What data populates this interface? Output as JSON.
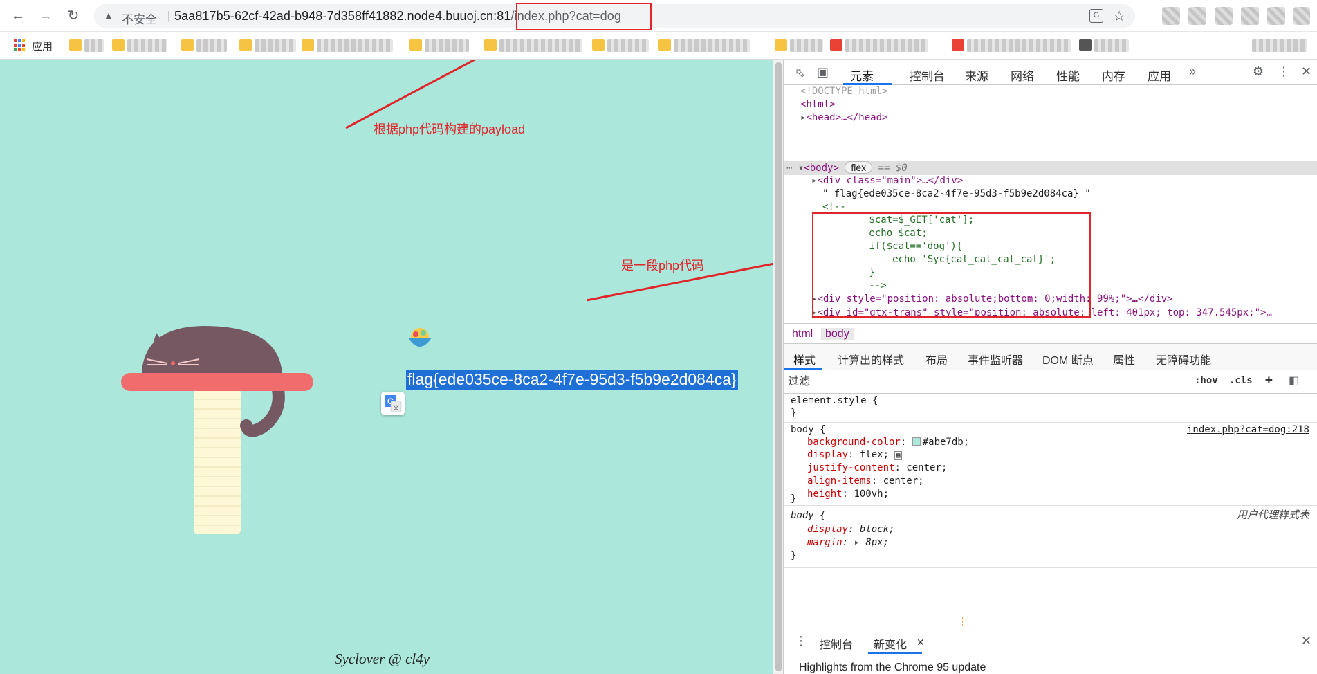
{
  "browser": {
    "insecure_label": "不安全",
    "url_host": "5aa817b5-62cf-42ad-b948-7d358ff41882.node4.buuoj.cn:81",
    "url_path": "/index.php?cat=dog",
    "apps_label": "应用"
  },
  "page": {
    "background": "#abe7db",
    "annotation_payload": "根据php代码构建的payload",
    "annotation_php": "是一段php代码",
    "flag_text": "flag{ede035ce-8ca2-4f7e-95d3-f5b9e2d084ca}",
    "footer": "Syclover @ cl4y",
    "accent_red": "#e0262b"
  },
  "devtools": {
    "tabs": [
      "元素",
      "控制台",
      "来源",
      "网络",
      "性能",
      "内存",
      "应用"
    ],
    "elements": {
      "doctype": "<!DOCTYPE html>",
      "html_open": "<html>",
      "head": "<head>…</head>",
      "body_tag": "<body>",
      "flex_badge": "flex",
      "eq0": "== $0",
      "div_main": "<div class=\"main\">…</div>",
      "text_node": "\" flag{ede035ce-8ca2-4f7e-95d3-f5b9e2d084ca} \"",
      "comment_lines": [
        "<!--",
        "        $cat=$_GET['cat'];",
        "        echo $cat;",
        "        if($cat=='dog'){",
        "            echo 'Syc{cat_cat_cat_cat}';",
        "        }",
        "        -->"
      ],
      "div_style": "<div style=\"position: absolute;bottom: 0;width: 99%;\">…</div>",
      "div_gtx": "<div id=\"gtx-trans\" style=\"position: absolute; left: 401px; top: 347.545px;\">…"
    },
    "breadcrumbs": [
      "html",
      "body"
    ],
    "styles_tabs": [
      "样式",
      "计算出的样式",
      "布局",
      "事件监听器",
      "DOM 断点",
      "属性",
      "无障碍功能"
    ],
    "filter_placeholder": "过滤",
    "filter_buttons": [
      ":hov",
      ".cls",
      "+"
    ],
    "element_style": "element.style {",
    "close_brace": "}",
    "rule_body": {
      "selector": "body {",
      "source": "index.php?cat=dog:218",
      "props": [
        {
          "name": "background-color",
          "value": "#abe7db;"
        },
        {
          "name": "display",
          "value": "flex;"
        },
        {
          "name": "justify-content",
          "value": "center;"
        },
        {
          "name": "align-items",
          "value": "center;"
        },
        {
          "name": "height",
          "value": "100vh;"
        }
      ]
    },
    "rule_ua": {
      "selector": "body {",
      "source": "用户代理样式表",
      "props": [
        {
          "name": "display",
          "value": "block;"
        },
        {
          "name": "margin",
          "value": "8px;"
        }
      ]
    },
    "drawer_tabs": [
      "控制台",
      "新变化"
    ],
    "drawer_text": "Highlights from the Chrome 95 update"
  }
}
